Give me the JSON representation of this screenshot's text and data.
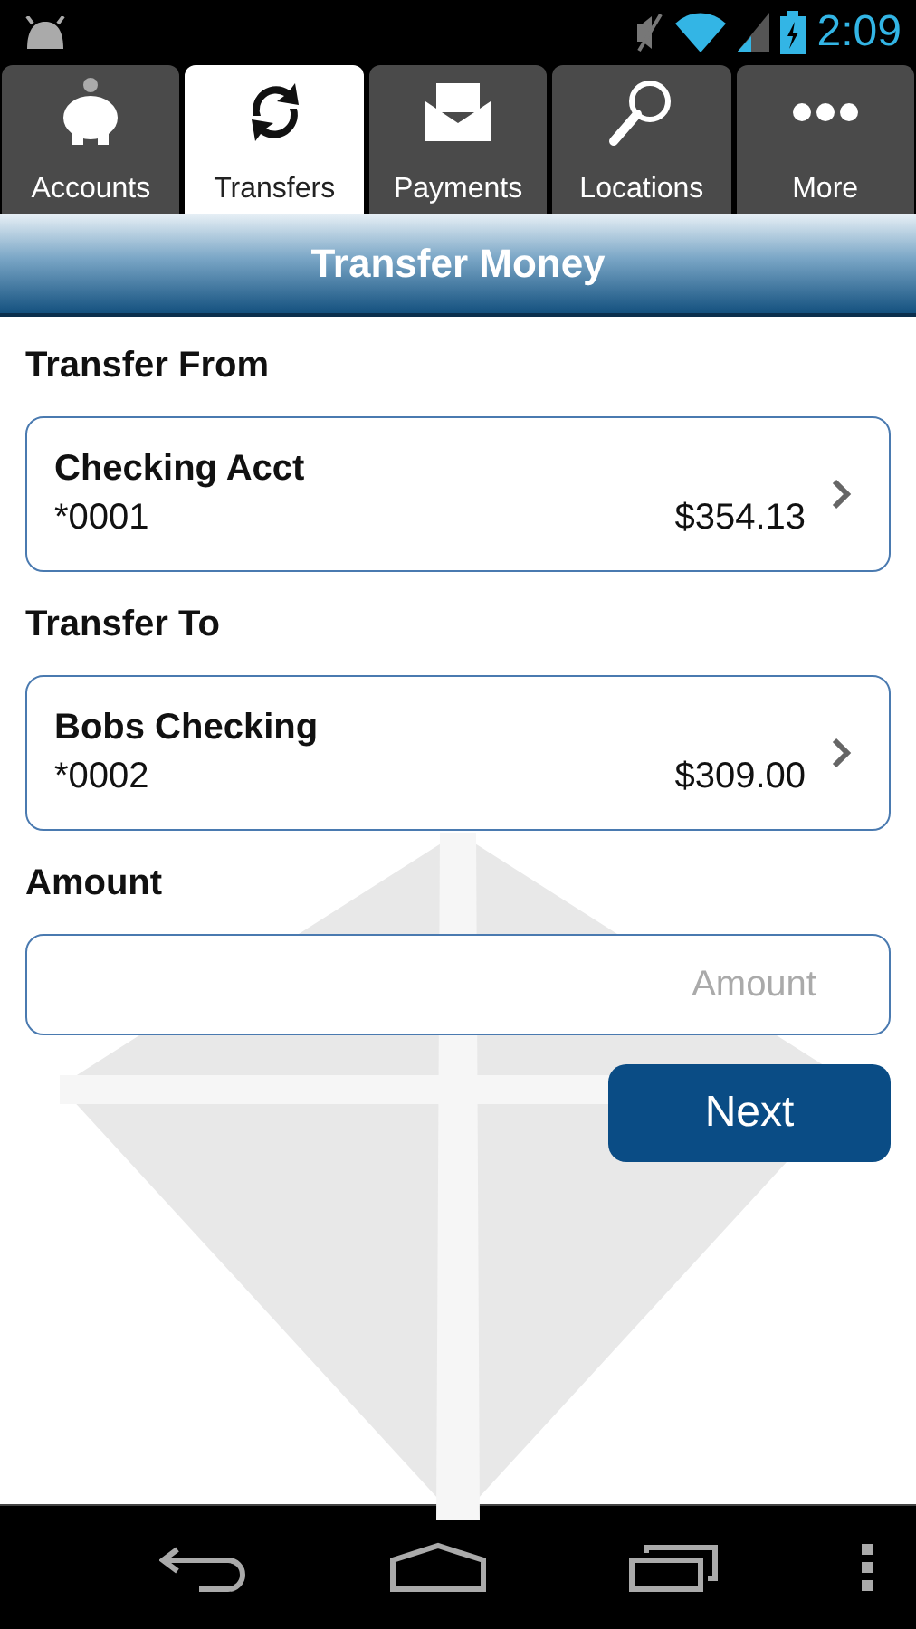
{
  "status_bar": {
    "time": "2:09"
  },
  "tabs": [
    {
      "label": "Accounts",
      "selected": false
    },
    {
      "label": "Transfers",
      "selected": true
    },
    {
      "label": "Payments",
      "selected": false
    },
    {
      "label": "Locations",
      "selected": false
    },
    {
      "label": "More",
      "selected": false
    }
  ],
  "header": {
    "title": "Transfer Money"
  },
  "sections": [
    {
      "label": "Transfer From",
      "account": {
        "name": "Checking Acct",
        "number": "*0001",
        "balance": "$354.13"
      }
    },
    {
      "label": "Transfer To",
      "account": {
        "name": "Bobs Checking",
        "number": "*0002",
        "balance": "$309.00"
      }
    }
  ],
  "amount": {
    "label": "Amount",
    "placeholder": "Amount"
  },
  "next_button": "Next"
}
